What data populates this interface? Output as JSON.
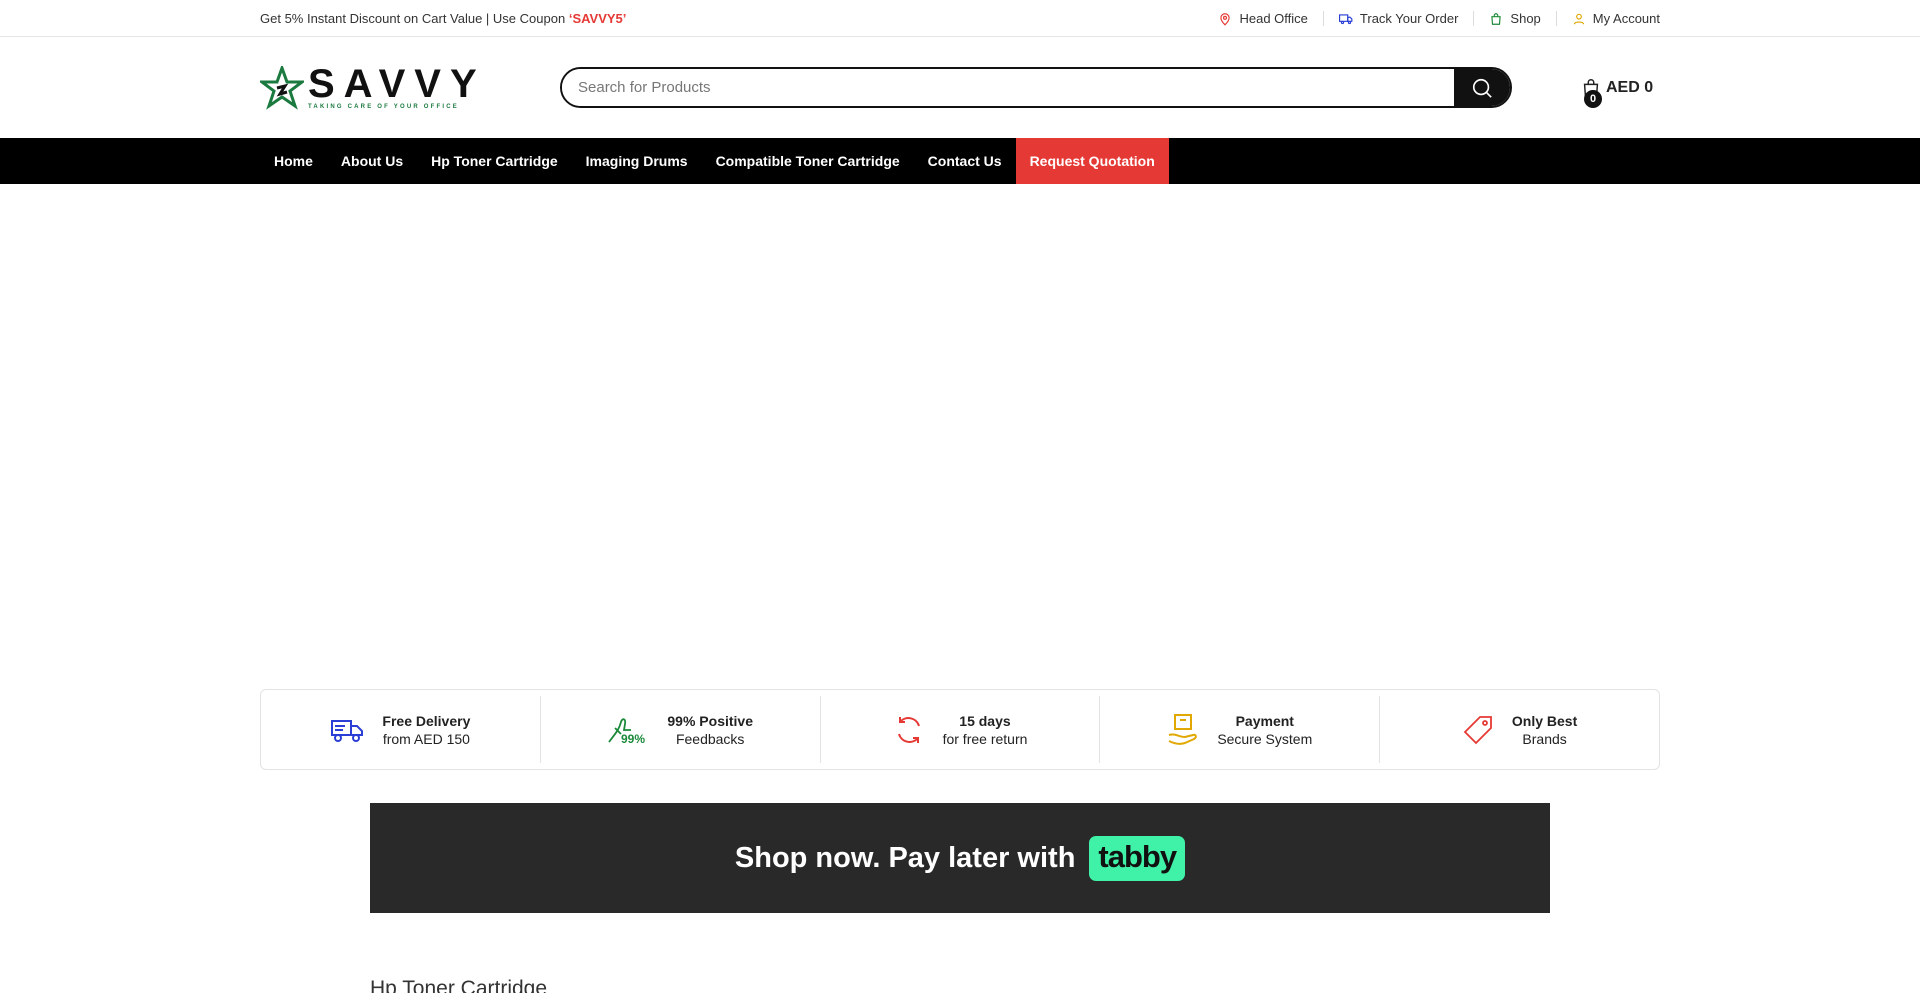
{
  "topbar": {
    "promo_text": "Get 5% Instant Discount on Cart Value | Use Coupon",
    "coupon": "‘SAVVY5’",
    "links": [
      {
        "label": "Head Office",
        "icon": "map-pin-icon",
        "color": "#e53935"
      },
      {
        "label": "Track Your Order",
        "icon": "truck-icon",
        "color": "#2b3fd6"
      },
      {
        "label": "Shop",
        "icon": "shopping-bag-icon",
        "color": "#1b8a3a"
      },
      {
        "label": "My Account",
        "icon": "user-icon",
        "color": "#e0a800"
      }
    ]
  },
  "header": {
    "logo_word": "SAVVY",
    "logo_tagline": "TAKING CARE OF YOUR OFFICE",
    "search_placeholder": "Search for Products",
    "cart_count": "0",
    "cart_amount": "AED 0"
  },
  "nav": {
    "items": [
      "Home",
      "About Us",
      "Hp Toner Cartridge",
      "Imaging Drums",
      "Compatible Toner Cartridge",
      "Contact Us"
    ],
    "quote_label": "Request Quotation"
  },
  "features": [
    {
      "title": "Free Delivery",
      "subtitle": "from AED 150",
      "icon": "delivery-truck-icon"
    },
    {
      "title": "99% Positive",
      "subtitle": "Feedbacks",
      "icon": "thumbs-up-99-icon",
      "badge": "99%"
    },
    {
      "title": "15 days",
      "subtitle": "for free return",
      "icon": "return-cycle-icon"
    },
    {
      "title": "Payment",
      "subtitle": "Secure System",
      "icon": "secure-payment-icon"
    },
    {
      "title": "Only Best",
      "subtitle": "Brands",
      "icon": "price-tag-icon"
    }
  ],
  "tabby": {
    "text": "Shop now. Pay later with",
    "logo": "tabby"
  },
  "section": {
    "title": "Hp Toner Cartridge"
  },
  "colors": {
    "accent_red": "#e53935",
    "nav_bg": "#000000",
    "brand_green": "#1b7a3f",
    "tabby_green": "#3ff2a8"
  }
}
